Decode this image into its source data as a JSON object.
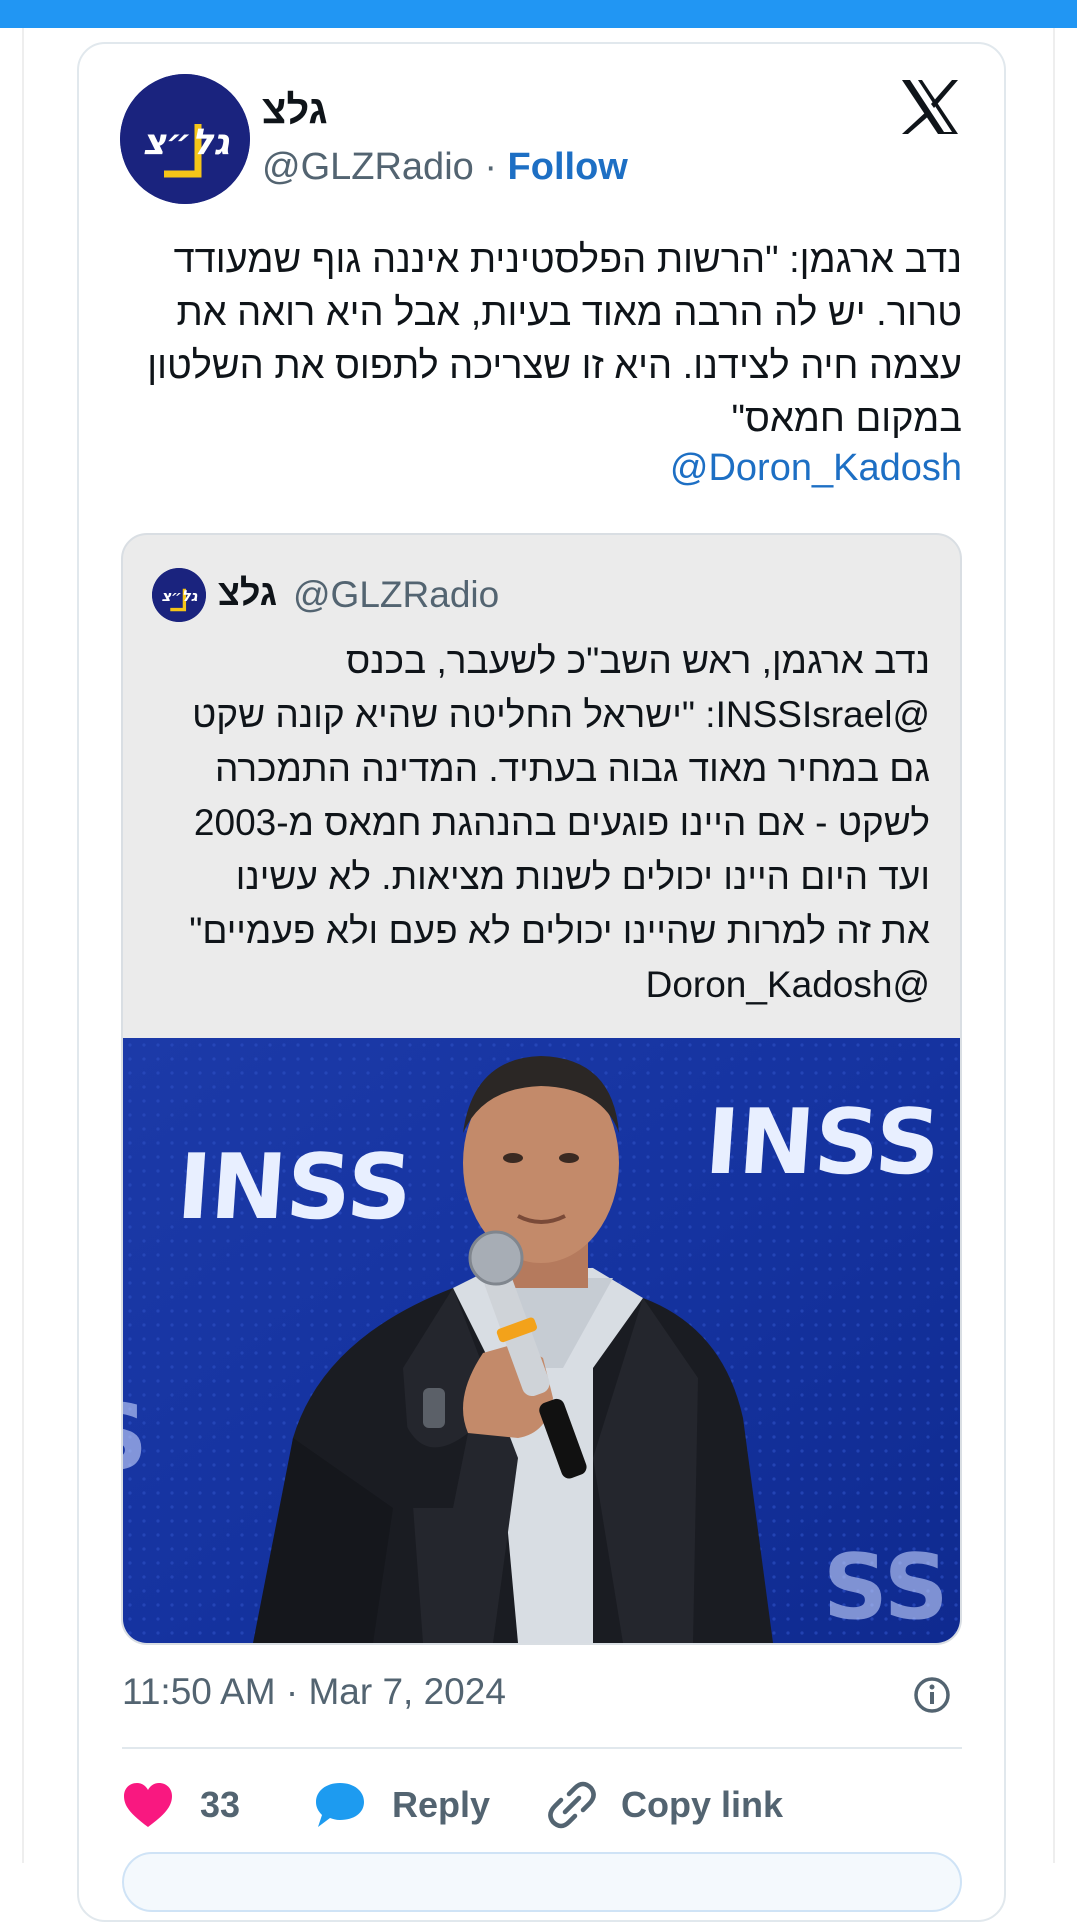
{
  "tweet": {
    "author_name": "גלצ",
    "handle": "@GLZRadio",
    "separator": "·",
    "follow_label": "Follow",
    "text_lines": [
      "נדב ארגמן: \"הרשות הפלסטינית איננה גוף שמעודד",
      "טרור. יש לה הרבה מאוד בעיות, אבל היא רואה את",
      "עצמה חיה לצידנו. היא זו שצריכה לתפוס את השלטון",
      "במקום חמאס\""
    ],
    "mention": "@Doron_Kadosh",
    "timestamp": "11:50 AM · Mar 7, 2024"
  },
  "quote": {
    "author_name": "גלצ",
    "handle": "@GLZRadio",
    "text_lines": [
      "נדב ארגמן, ראש השב\"כ לשעבר, בכנס",
      "@INSSIsrael: \"ישראל החליטה שהיא קונה שקט",
      "גם במחיר מאוד גבוה בעתיד. המדינה התמכרה",
      "לשקט - אם היינו פוגעים בהנהגת חמאס מ-2003",
      "ועד היום היינו יכולים לשנות מציאות. לא עשינו",
      "את זה למרות שהיינו יכולים לא פעם ולא פעמיים\"",
      "@Doron_Kadosh"
    ],
    "image_logo_left": "INSS",
    "image_logo_right": "INSS"
  },
  "actions": {
    "like_count": "33",
    "reply_label": "Reply",
    "copy_link_label": "Copy link"
  },
  "colors": {
    "accent": "#1d6fc4",
    "topbar": "#2196f3",
    "like": "#f91880",
    "reply": "#1d9bf0"
  },
  "icons": {
    "brand": "x-logo-icon",
    "like": "heart-icon",
    "reply": "speech-bubble-icon",
    "copy": "link-icon",
    "info": "info-icon"
  }
}
